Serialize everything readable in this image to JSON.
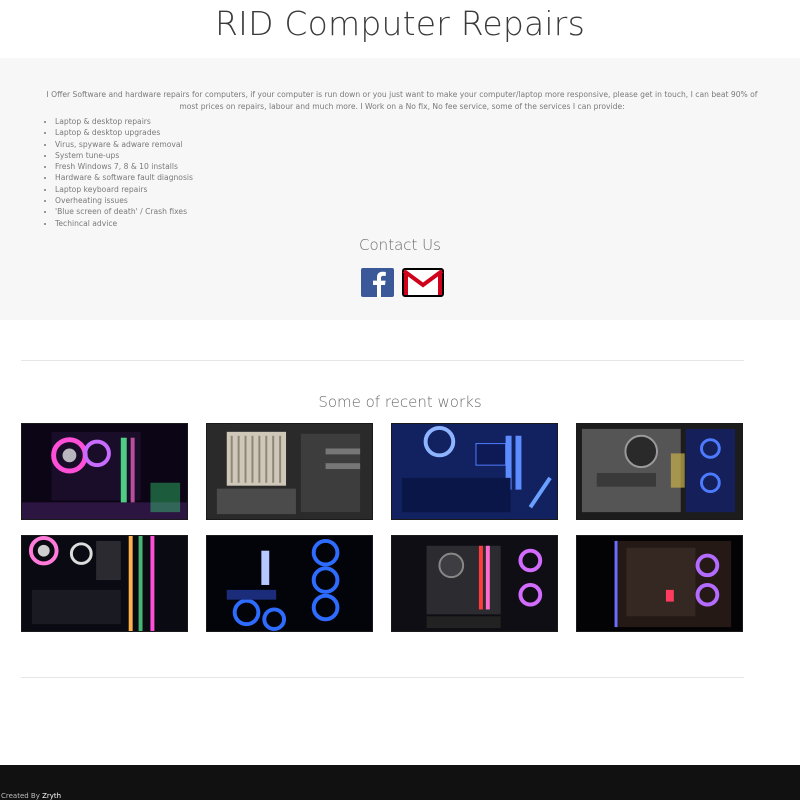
{
  "header": {
    "title": "RID Computer Repairs"
  },
  "about": {
    "intro": "I Offer Software and hardware repairs for computers, if your computer is run down or you just want to make your computer/laptop more responsive, please get in touch, I can beat 90% of most prices on repairs, labour and much more. I Work on a No fix, No fee service, some of the services I can provide:",
    "services": [
      "Laptop & desktop repairs",
      "Laptop & desktop upgrades",
      "Virus, spyware & adware removal",
      "System tune-ups",
      "Fresh Windows 7, 8 & 10 installs",
      "Hardware & software fault diagnosis",
      "Laptop keyboard repairs",
      "Overheating issues",
      "'Blue screen of death' / Crash fixes",
      "Techincal advice"
    ]
  },
  "contact": {
    "heading": "Contact Us",
    "links": [
      {
        "icon": "facebook-icon",
        "color": "#3b5998"
      },
      {
        "icon": "gmail-icon",
        "color": "#d0021b"
      }
    ]
  },
  "works": {
    "heading": "Some of recent works",
    "images": [
      {
        "subject": "pc build photo",
        "tint": "#ff3fd0"
      },
      {
        "subject": "pc build photo",
        "tint": "#c9c9c9"
      },
      {
        "subject": "pc build photo",
        "tint": "#2c5bff"
      },
      {
        "subject": "pc build photo",
        "tint": "#8a8a8a"
      },
      {
        "subject": "pc build photo",
        "tint": "#ff7ad9"
      },
      {
        "subject": "pc build photo",
        "tint": "#2a6bff"
      },
      {
        "subject": "pc build photo",
        "tint": "#b04cff"
      },
      {
        "subject": "pc build photo",
        "tint": "#6c6cff"
      }
    ]
  },
  "footer": {
    "prefix": "Created By ",
    "author": "Zryth"
  }
}
